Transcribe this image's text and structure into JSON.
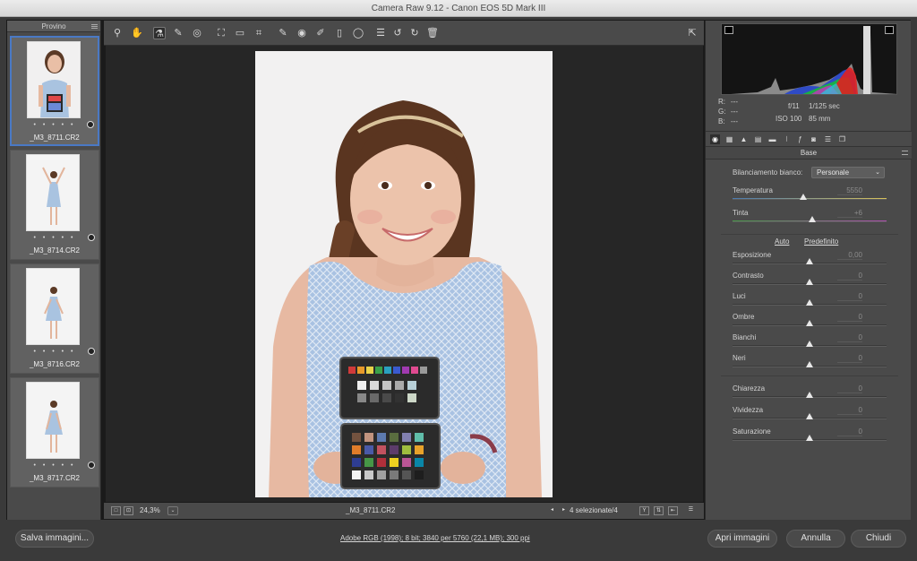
{
  "window": {
    "title": "Camera Raw 9.12  -  Canon EOS 5D Mark III"
  },
  "filmstrip": {
    "title": "Provino",
    "items": [
      {
        "filename": "_M3_8711.CR2",
        "rating": "• • • • •",
        "selected": true
      },
      {
        "filename": "_M3_8714.CR2",
        "rating": "• • • • •",
        "selected": false
      },
      {
        "filename": "_M3_8716.CR2",
        "rating": "• • • • •",
        "selected": false
      },
      {
        "filename": "_M3_8717.CR2",
        "rating": "• • • • •",
        "selected": false
      }
    ]
  },
  "toolbar": {
    "icons": {
      "zoom": "⚲",
      "hand": "✋",
      "white_balance": "⚗",
      "color_sampler": "✎",
      "targeted_adjust": "◎",
      "crop": "⛶",
      "straighten": "▭",
      "transform": "⌗",
      "spot_removal": "✎",
      "red_eye": "◉",
      "adjustment_brush": "✐",
      "graduated_filter": "▯",
      "radial_filter": "◯",
      "presets_list": "☰",
      "rotate_ccw": "↺",
      "rotate_cw": "↻",
      "trash": "🗑",
      "fullscreen": "⇱"
    }
  },
  "status": {
    "zoom": "24,3%",
    "zoom_chevron": "⌄",
    "filename": "_M3_8711.CR2",
    "selection": "4 selezionate/4",
    "prev": "◂",
    "next": "▸",
    "compare_y": "Y",
    "compare_swap": "⇅",
    "copy": "⇤",
    "settings": "☰",
    "fit_a": "□",
    "fit_b": "⊡"
  },
  "histogram": {
    "rgb": {
      "r_label": "R:",
      "g_label": "G:",
      "b_label": "B:",
      "r": "---",
      "g": "---",
      "b": "---"
    },
    "exif": {
      "aperture": "f/11",
      "shutter": "1/125 sec",
      "iso": "ISO 100",
      "focal": "85 mm"
    }
  },
  "panel": {
    "section_title": "Base",
    "wb_label": "Bilanciamento bianco:",
    "wb_value": "Personale",
    "auto_label": "Auto",
    "default_label": "Predefinito",
    "sliders": [
      {
        "label": "Temperatura",
        "value": "5550",
        "position": 0.46
      },
      {
        "label": "Tinta",
        "value": "+6",
        "position": 0.52
      },
      {
        "label": "Esposizione",
        "value": "0,00",
        "position": 0.5
      },
      {
        "label": "Contrasto",
        "value": "0",
        "position": 0.5
      },
      {
        "label": "Luci",
        "value": "0",
        "position": 0.5
      },
      {
        "label": "Ombre",
        "value": "0",
        "position": 0.5
      },
      {
        "label": "Bianchi",
        "value": "0",
        "position": 0.5
      },
      {
        "label": "Neri",
        "value": "0",
        "position": 0.5
      },
      {
        "label": "Chiarezza",
        "value": "0",
        "position": 0.5
      },
      {
        "label": "Vividezza",
        "value": "0",
        "position": 0.5
      },
      {
        "label": "Saturazione",
        "value": "0",
        "position": 0.5
      }
    ]
  },
  "bottom": {
    "save": "Salva immagini...",
    "workflow": "Adobe RGB (1998); 8 bit; 3840 per 5760 (22,1 MB); 300 ppi",
    "open": "Apri immagini",
    "cancel": "Annulla",
    "close": "Chiudi"
  }
}
